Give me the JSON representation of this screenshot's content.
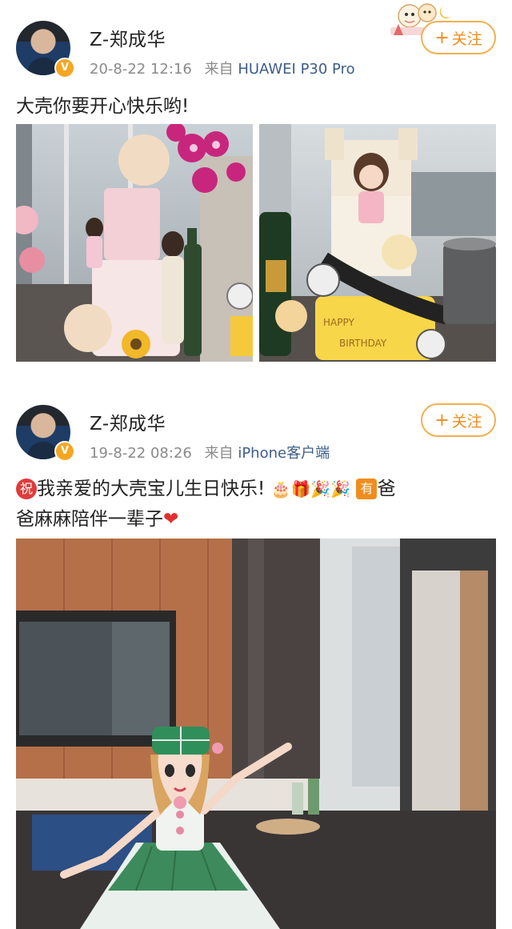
{
  "post1": {
    "username": "Z-郑成华",
    "time": "20-8-22 12:16",
    "source_prefix": "来自",
    "source": "HUAWEI P30 Pro",
    "follow_label": "关注",
    "text": "大壳你要开心快乐哟!"
  },
  "post2": {
    "username": "Z-郑成华",
    "time": "19-8-22 08:26",
    "source_prefix": "来自",
    "source": "iPhone客户端",
    "follow_label": "关注",
    "text_tag": "祝",
    "text_main": "我亲爱的大壳宝儿生日快乐!",
    "text_tag2": "有",
    "text_line1_end": "爸",
    "text_line2": "爸麻麻陪伴一辈子"
  },
  "colors": {
    "accent": "#f08d1e",
    "source_link": "#3e5d8a",
    "meta_gray": "#8a8a8a",
    "verified": "#f5a623"
  }
}
